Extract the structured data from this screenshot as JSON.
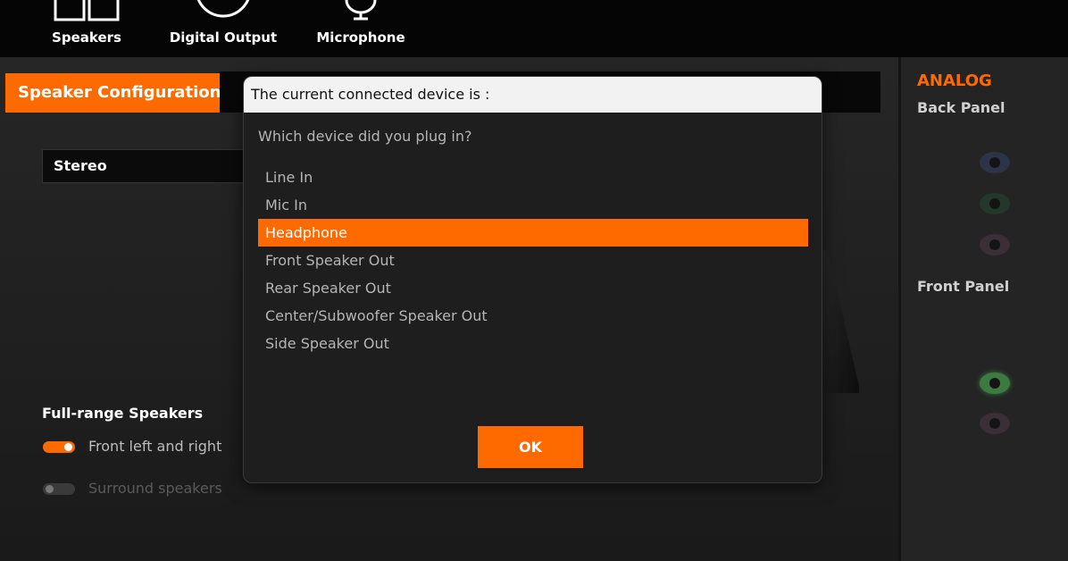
{
  "topbar": {
    "tabs": [
      {
        "label": "Speakers",
        "icon": "speakers-icon"
      },
      {
        "label": "Digital Output",
        "icon": "digital-output-icon"
      },
      {
        "label": "Microphone",
        "icon": "microphone-icon"
      }
    ],
    "active_tab": "Speakers"
  },
  "main": {
    "config_tab_label": "Speaker Configuration",
    "speaker_mode": "Stereo",
    "full_range": {
      "title": "Full-range Speakers",
      "options": [
        {
          "label": "Front left and right",
          "on": true
        },
        {
          "label": "Surround speakers",
          "on": false
        }
      ]
    }
  },
  "right_panel": {
    "title": "ANALOG",
    "back_panel_label": "Back Panel",
    "front_panel_label": "Front Panel",
    "back_jacks": [
      "blue",
      "green",
      "pink"
    ],
    "front_jacks": [
      "green",
      "pink"
    ]
  },
  "dialog": {
    "header": "The current connected device is :",
    "question": "Which device did you plug in?",
    "options": [
      "Line In",
      "Mic In",
      "Headphone",
      "Front Speaker Out",
      "Rear Speaker Out",
      "Center/Subwoofer Speaker Out",
      "Side Speaker Out"
    ],
    "selected": "Headphone",
    "ok_label": "OK"
  },
  "colors": {
    "accent": "#ff6a00",
    "background": "#212121",
    "topbar": "#050505",
    "dialog_header": "#f2f2f2"
  }
}
